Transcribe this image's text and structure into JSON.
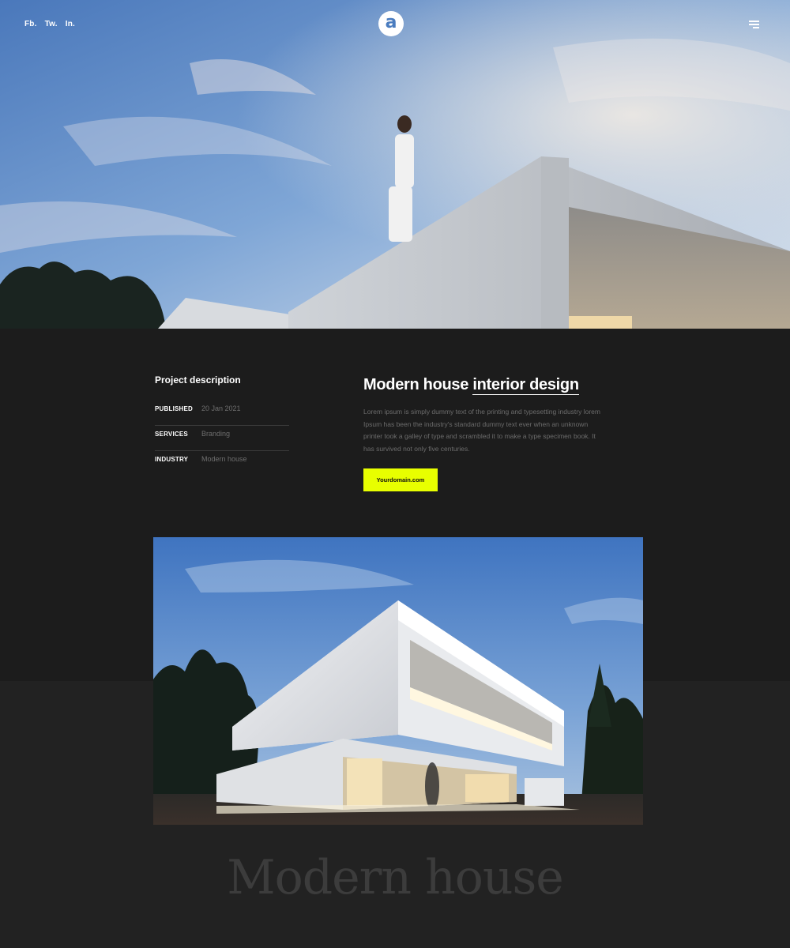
{
  "header": {
    "social": [
      "Fb.",
      "Tw.",
      "In."
    ],
    "logo_letter": "a",
    "menu_icon": "hamburger-menu-icon"
  },
  "project": {
    "description_heading": "Project description",
    "meta": [
      {
        "key": "PUBLISHED",
        "value": "20 Jan 2021"
      },
      {
        "key": "SERVICES",
        "value": "Branding"
      },
      {
        "key": "INDUSTRY",
        "value": "Modern house"
      }
    ],
    "title_plain": "Modern house",
    "title_underlined": "interior design",
    "body": "Lorem ipsum is simply dummy text of the printing and typesetting industry lorem Ipsum has been the industry's standard dummy text ever when an unknown printer took a galley of type and scrambled it to make a type specimen book. It has survived not only five centuries.",
    "cta_label": "Yourdomain.com"
  },
  "footer_title": "Modern house",
  "colors": {
    "accent": "#e8ff00",
    "background": "#1c1c1c",
    "background_lower": "#222222",
    "muted_text": "#6c6c6c"
  }
}
